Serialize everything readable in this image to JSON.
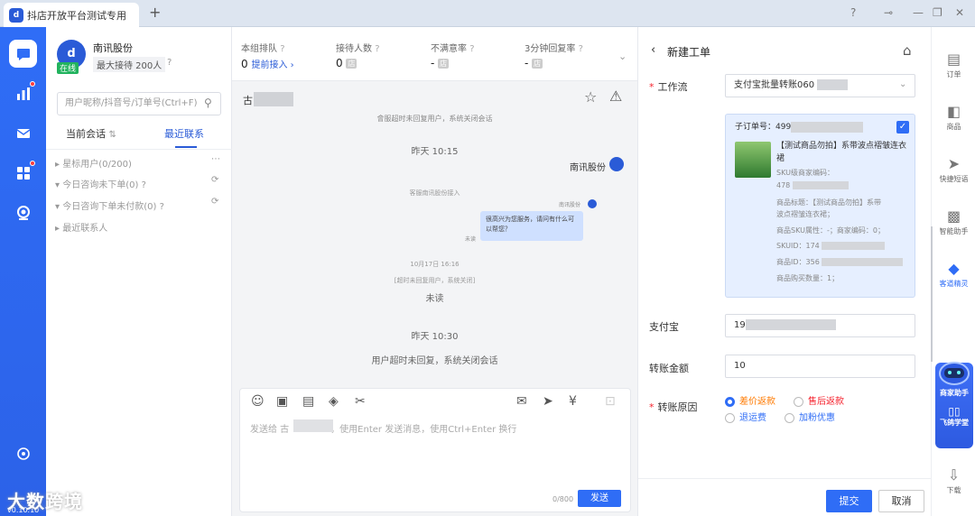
{
  "window": {
    "tab_title": "抖店开放平台测试专用",
    "logo_text": "d"
  },
  "rail": {
    "version": "v0.10.10"
  },
  "shop": {
    "name": "南讯股份",
    "status": "在线",
    "max_receive": "最大接待 200人"
  },
  "contacts": {
    "search_placeholder": "用户昵称/抖音号/订单号(Ctrl+F)",
    "tabs": [
      "当前会话",
      "最近联系"
    ],
    "tab_sort_glyph": "⇅",
    "groups": [
      {
        "label": "星标用户(0/200)",
        "arrow": "▸",
        "action": "⋯"
      },
      {
        "label": "今日咨询未下单(0)",
        "arrow": "▾",
        "action": "⟳"
      },
      {
        "label": "今日咨询下单未付款(0)",
        "arrow": "▾",
        "action": "⟳"
      },
      {
        "label": "最近联系人",
        "arrow": "▸",
        "action": ""
      }
    ]
  },
  "stats": [
    {
      "label": "本组排队",
      "value": "0",
      "link": "提前接入 ›"
    },
    {
      "label": "接待人数",
      "value": "0",
      "badge": "店"
    },
    {
      "label": "不满意率",
      "value": "-",
      "badge": "店"
    },
    {
      "label": "3分钟回复率",
      "value": "-",
      "badge": "店"
    }
  ],
  "chat": {
    "customer_prefix": "古",
    "msg_cut_top": "會服超时未回复用户，系统关闭会话",
    "time_1": "昨天 10:15",
    "sender": "南讯股份",
    "small_sys_1": "客服南讯股份接入",
    "small_sender": "南讯股份",
    "bubble_text": "很高兴为您服务，请问有什么可以帮您？",
    "small_unread": "未读",
    "small_time": "10月17日 16:16",
    "small_sys_2": "[超时未回复用户，系统关闭]",
    "unread": "未读",
    "time_2": "昨天 10:30",
    "sys_closed": "用户超时未回复，系统关闭会话",
    "input_placeholder_prefix": "发送给 古",
    "input_placeholder_suffix": "，使用Enter 发送消息，使用Ctrl+Enter 换行",
    "counter": "0/800",
    "send": "发送"
  },
  "ticket": {
    "title": "新建工单",
    "workflow_label": "工作流",
    "workflow_value": "支付宝批量转账060",
    "sub_order_label": "子订单号：499",
    "product_title": "【测试商品勿拍】系带波点褶皱连衣裙",
    "lines": [
      "SKU级商家编码：",
      "478",
      "商品标题：【测试商品勿拍】系带",
      "波点褶皱连衣裙；",
      "商品SKU属性：-；商家编码：0；",
      "SKUID：174",
      "商品ID：356",
      "商品购买数量：1；"
    ],
    "alipay_label": "支付宝",
    "alipay_value": "19",
    "amount_label": "转账金额",
    "amount_value": "10",
    "reason_label": "转账原因",
    "reasons": [
      {
        "label": "差价返款",
        "checked": true,
        "color": "#ff7a00"
      },
      {
        "label": "售后返款",
        "checked": false,
        "color": "#f5222d"
      },
      {
        "label": "退运费",
        "checked": false,
        "color": "#2f6df6"
      },
      {
        "label": "加粉优惠",
        "checked": false,
        "color": "#2f6df6"
      }
    ],
    "submit": "提交",
    "cancel": "取消"
  },
  "right_rail": [
    {
      "label": "订单",
      "icon": "order-icon"
    },
    {
      "label": "商品",
      "icon": "product-icon"
    },
    {
      "label": "快捷短语",
      "icon": "send-icon"
    },
    {
      "label": "智能助手",
      "icon": "robot-icon"
    },
    {
      "label": "客道精灵",
      "icon": "cube-icon"
    },
    {
      "label": "商家助手",
      "icon": "assistant-icon"
    },
    {
      "label": "飞鸽学堂",
      "icon": "book-icon"
    },
    {
      "label": "下载",
      "icon": "download-icon"
    }
  ],
  "watermark": "大数跨境"
}
